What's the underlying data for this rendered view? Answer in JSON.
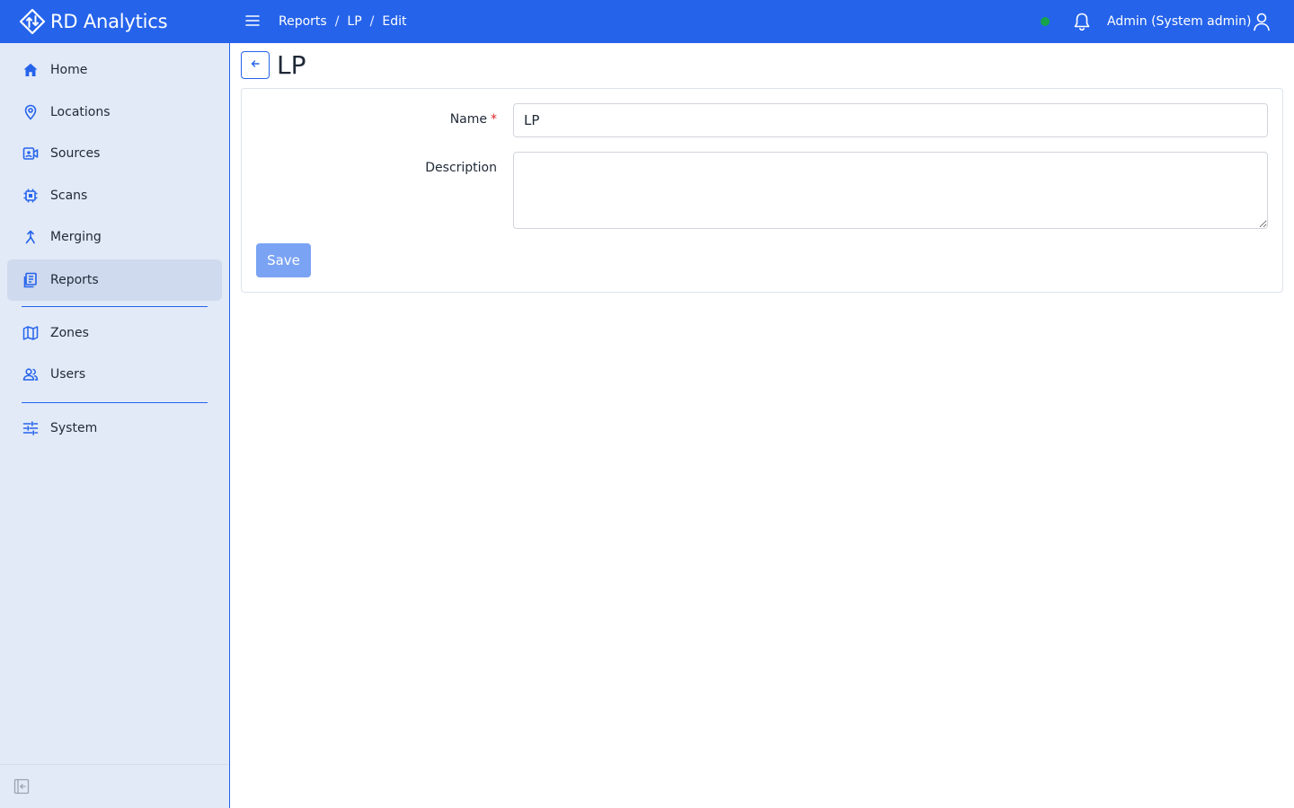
{
  "app": {
    "brand_name": "RD Analytics",
    "brand_icon": "rd-logo-icon",
    "accent_color": "#2563eb"
  },
  "topbar": {
    "menu_icon": "hamburger-icon",
    "breadcrumb": [
      {
        "label": "Reports"
      },
      {
        "label": "LP"
      },
      {
        "label": "Edit"
      }
    ],
    "breadcrumb_separator": "/",
    "status_color": "#16a34a",
    "notifications_icon": "bell-icon",
    "user_label": "Admin (System admin)",
    "user_icon": "user-icon"
  },
  "sidebar": {
    "items": [
      {
        "label": "Home",
        "icon": "home-icon"
      },
      {
        "label": "Locations",
        "icon": "map-pin-icon"
      },
      {
        "label": "Sources",
        "icon": "camera-icon"
      },
      {
        "label": "Scans",
        "icon": "chip-icon"
      },
      {
        "label": "Merging",
        "icon": "merge-icon"
      },
      {
        "label": "Reports",
        "icon": "report-icon",
        "active": true
      },
      {
        "label": "Zones",
        "icon": "map-icon"
      },
      {
        "label": "Users",
        "icon": "users-icon"
      },
      {
        "label": "System",
        "icon": "sliders-icon"
      }
    ],
    "collapse_icon": "collapse-sidebar-icon"
  },
  "main": {
    "title": "LP",
    "back_icon": "arrow-left-icon",
    "form": {
      "name_label": "Name",
      "name_required_mark": "*",
      "name_value": "LP",
      "description_label": "Description",
      "description_value": "",
      "save_label": "Save"
    }
  }
}
